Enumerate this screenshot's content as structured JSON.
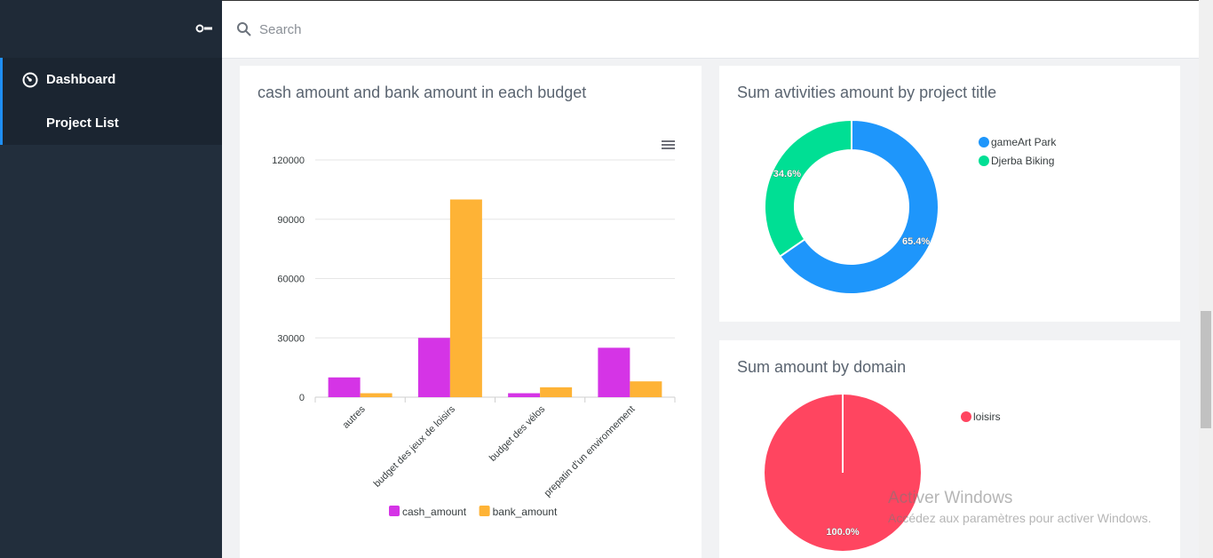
{
  "sidebar": {
    "toggle_icon": "toggle-switch-icon",
    "items": [
      {
        "label": "Dashboard",
        "icon": "dashboard-gauge-icon"
      },
      {
        "label": "Project List"
      }
    ]
  },
  "topbar": {
    "search_placeholder": "Search",
    "search_icon": "search-icon"
  },
  "colors": {
    "cash": "#d534e6",
    "bank": "#feb336",
    "gameart": "#1e96fb",
    "djerba": "#00df94",
    "loisirs": "#ff4560"
  },
  "cards": {
    "budget_title": "cash amount and bank amount in each budget",
    "activities_title": "Sum avtivities amount by project title",
    "domain_title": "Sum amount by domain",
    "menu_icon": "hamburger-menu-icon"
  },
  "chart_data": [
    {
      "type": "bar",
      "title": "cash amount and bank amount in each budget",
      "categories": [
        "autres",
        "budget des jeux de loisirs",
        "budget des vélos",
        "prepatin d'un environnement"
      ],
      "series": [
        {
          "name": "cash_amount",
          "values": [
            10000,
            30000,
            2000,
            25000
          ]
        },
        {
          "name": "bank_amount",
          "values": [
            2000,
            100000,
            5000,
            8000
          ]
        }
      ],
      "yticks": [
        "0",
        "30000",
        "60000",
        "90000",
        "120000"
      ],
      "ylim": [
        0,
        120000
      ],
      "grid": true,
      "legend": "bottom"
    },
    {
      "type": "pie",
      "title": "Sum avtivities amount by project title",
      "labels": [
        "gameArt Park",
        "Djerba Biking"
      ],
      "values": [
        65.4,
        34.6
      ],
      "data_labels": [
        "65.4%",
        "34.6%"
      ],
      "donut": true,
      "legend": "top-right"
    },
    {
      "type": "pie",
      "title": "Sum amount by domain",
      "labels": [
        "loisirs"
      ],
      "values": [
        100
      ],
      "data_labels": [
        "100.0%"
      ],
      "legend": "top-right"
    }
  ],
  "watermark": {
    "title": "Activer Windows",
    "subtitle": "Accédez aux paramètres pour activer Windows."
  }
}
